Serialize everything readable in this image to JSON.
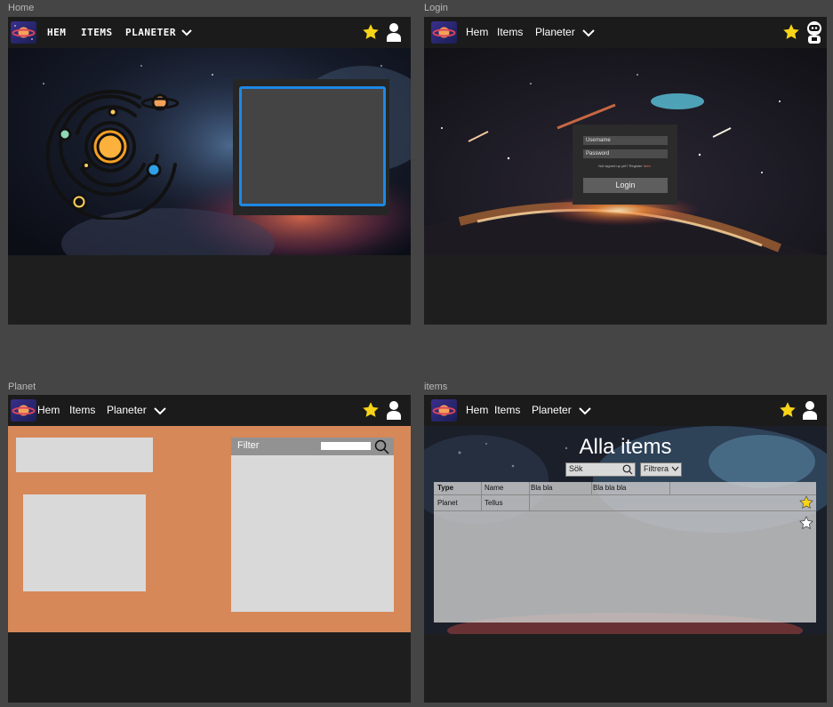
{
  "frames": {
    "home": {
      "label": "Home",
      "nav": {
        "hem": "HEM",
        "items": "ITEMS",
        "planeter": "PLANETER"
      }
    },
    "login": {
      "label": "Login",
      "nav": {
        "hem": "Hem",
        "items": "Items",
        "planeter": "Planeter"
      },
      "form": {
        "username_placeholder": "Username",
        "password_placeholder": "Password",
        "register_prefix": "Not signed up yet? Register",
        "register_link": "here.",
        "login_button": "Login"
      }
    },
    "planet": {
      "label": "Planet",
      "nav": {
        "hem": "Hem",
        "items": "Items",
        "planeter": "Planeter"
      },
      "filter_label": "Filter"
    },
    "items": {
      "label": "items",
      "nav": {
        "hem": "Hem",
        "items": "Items",
        "planeter": "Planeter"
      },
      "title": "Alla items",
      "search_placeholder": "Sök",
      "filter_select": "Filtrera",
      "table": {
        "headers": [
          "Type",
          "Name",
          "Bla bla",
          "Bla bla bla"
        ],
        "rows": [
          {
            "type": "Planet",
            "name": "Tellus",
            "favorite": true
          }
        ]
      }
    }
  },
  "colors": {
    "canvas": "#454545",
    "frame_bg": "#1e1e1e",
    "nav_bg": "#1b1b1b",
    "star": "#f7d417",
    "planet_bg": "#d68859",
    "accent_blue": "#1e88e5"
  },
  "icons": [
    "planet-logo-icon",
    "star-icon",
    "user-icon",
    "astronaut-icon",
    "chevron-down-icon",
    "search-icon",
    "solar-system-icon"
  ]
}
